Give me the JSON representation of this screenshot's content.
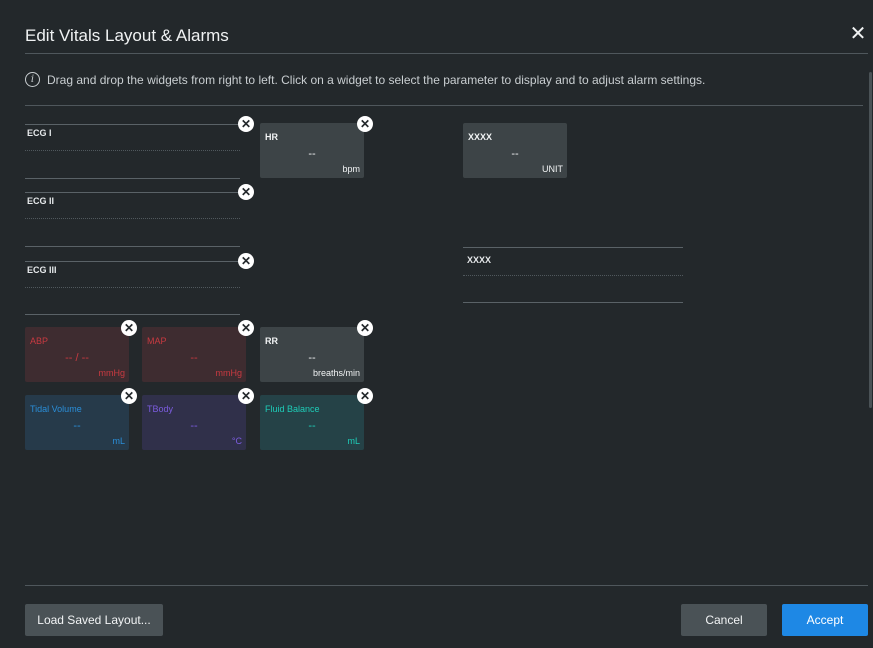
{
  "dialog": {
    "title": "Edit Vitals Layout & Alarms",
    "close_glyph": "✕",
    "info_text": "Drag and drop the widgets from right to left. Click on a widget to select the parameter to display and to adjust alarm settings."
  },
  "waveforms": [
    {
      "label": "ECG I"
    },
    {
      "label": "ECG II"
    },
    {
      "label": "ECG III"
    }
  ],
  "right_waveform": {
    "label": "XXXX"
  },
  "tiles": {
    "hr": {
      "name": "HR",
      "value": "--",
      "unit": "bpm"
    },
    "xxxx": {
      "name": "XXXX",
      "value": "--",
      "unit": "UNIT"
    },
    "abp": {
      "name": "ABP",
      "value": "-- / --",
      "unit": "mmHg"
    },
    "map": {
      "name": "MAP",
      "value": "--",
      "unit": "mmHg"
    },
    "rr": {
      "name": "RR",
      "value": "--",
      "unit": "breaths/min"
    },
    "tidal": {
      "name": "Tidal Volume",
      "value": "--",
      "unit": "mL"
    },
    "tbody": {
      "name": "TBody",
      "value": "--",
      "unit": "°C"
    },
    "fluid": {
      "name": "Fluid Balance",
      "value": "--",
      "unit": "mL"
    }
  },
  "footer": {
    "load_label": "Load Saved Layout...",
    "cancel_label": "Cancel",
    "accept_label": "Accept"
  },
  "icons": {
    "remove": "remove-icon",
    "info": "info-icon",
    "close": "close-icon"
  },
  "colors": {
    "background": "#23282b",
    "accent": "#1e88e5",
    "alarm_red": "#c83a41",
    "blue": "#2a8ed8",
    "purple": "#7c5ce0",
    "teal": "#1ecdb8"
  }
}
